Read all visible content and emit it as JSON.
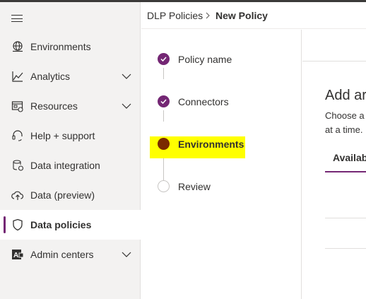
{
  "sidebar": {
    "items": [
      {
        "label": "Environments",
        "icon": "globe-icon",
        "has_chevron": false
      },
      {
        "label": "Analytics",
        "icon": "chart-line-icon",
        "has_chevron": true
      },
      {
        "label": "Resources",
        "icon": "resources-icon",
        "has_chevron": true
      },
      {
        "label": "Help + support",
        "icon": "headset-icon",
        "has_chevron": false
      },
      {
        "label": "Data integration",
        "icon": "database-icon",
        "has_chevron": false
      },
      {
        "label": "Data (preview)",
        "icon": "cloud-upload-icon",
        "has_chevron": false
      },
      {
        "label": "Data policies",
        "icon": "shield-icon",
        "has_chevron": false,
        "active": true
      },
      {
        "label": "Admin centers",
        "icon": "admin-centers-icon",
        "has_chevron": true
      }
    ]
  },
  "breadcrumb": {
    "parent": "DLP Policies",
    "current": "New Policy"
  },
  "wizard": {
    "steps": [
      {
        "label": "Policy name",
        "state": "done"
      },
      {
        "label": "Connectors",
        "state": "done"
      },
      {
        "label": "Environments",
        "state": "current"
      },
      {
        "label": "Review",
        "state": "todo"
      }
    ]
  },
  "main": {
    "title": "Add ar",
    "desc_line1": "Choose a",
    "desc_line2": "at a time.",
    "tab_label": "Availab"
  },
  "colors": {
    "accent": "#742774",
    "current_step": "#7a2a00",
    "highlight": "#ffff00"
  }
}
